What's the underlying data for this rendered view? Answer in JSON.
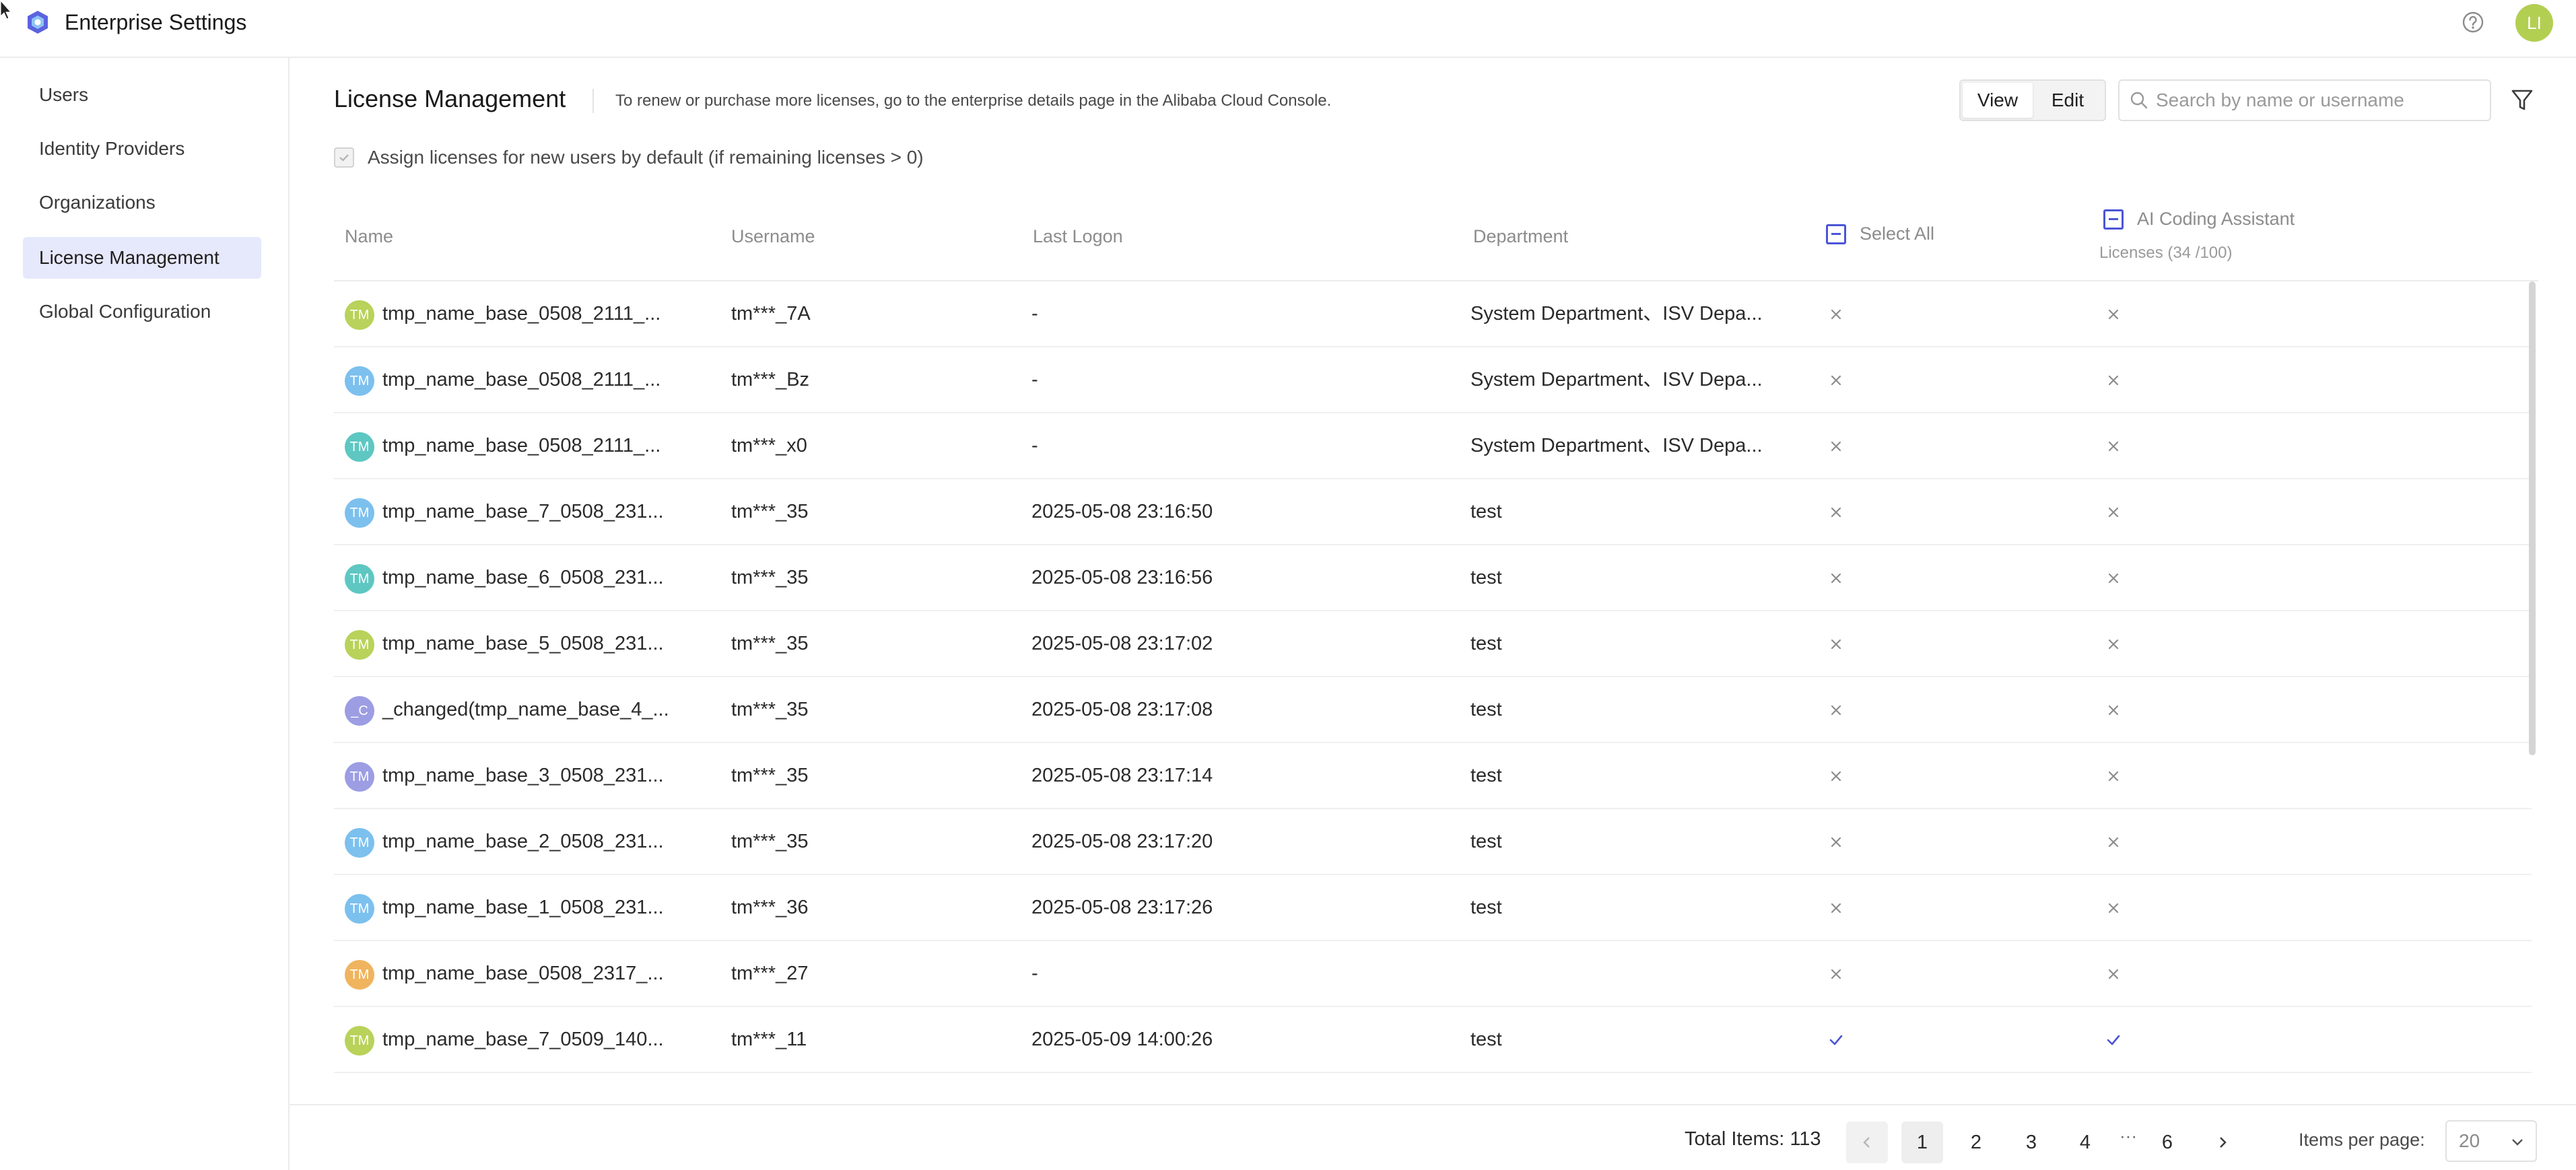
{
  "app": {
    "title": "Enterprise Settings",
    "avatar_initials": "LI"
  },
  "sidebar": {
    "items": [
      {
        "label": "Users"
      },
      {
        "label": "Identity Providers"
      },
      {
        "label": "Organizations"
      },
      {
        "label": "License Management",
        "active": true
      },
      {
        "label": "Global Configuration"
      }
    ]
  },
  "main": {
    "title": "License Management",
    "hint": "To renew or purchase more licenses, go to the enterprise details page in the Alibaba Cloud Console.",
    "view_label": "View",
    "edit_label": "Edit",
    "search_placeholder": "Search by name or username",
    "assign_default_label": "Assign licenses for new users by default (if remaining licenses > 0)"
  },
  "table": {
    "columns": {
      "name": "Name",
      "username": "Username",
      "last_logon": "Last Logon",
      "department": "Department",
      "select_all": "Select All",
      "product": "AI Coding Assistant",
      "product_sub": "Licenses (34 /100)"
    },
    "rows": [
      {
        "initials": "TM",
        "avatar_color": "#b8d25a",
        "name": "tmp_name_base_0508_2111_...",
        "username": "tm***_7A",
        "last_logon": "-",
        "department": "System Department、ISV Depa...",
        "select": "x",
        "license": "x"
      },
      {
        "initials": "TM",
        "avatar_color": "#7cc0ee",
        "name": "tmp_name_base_0508_2111_...",
        "username": "tm***_Bz",
        "last_logon": "-",
        "department": "System Department、ISV Depa...",
        "select": "x",
        "license": "x"
      },
      {
        "initials": "TM",
        "avatar_color": "#5ec7c2",
        "name": "tmp_name_base_0508_2111_...",
        "username": "tm***_x0",
        "last_logon": "-",
        "department": "System Department、ISV Depa...",
        "select": "x",
        "license": "x"
      },
      {
        "initials": "TM",
        "avatar_color": "#7cc0ee",
        "name": "tmp_name_base_7_0508_231...",
        "username": "tm***_35",
        "last_logon": "2025-05-08 23:16:50",
        "department": "test",
        "select": "x",
        "license": "x"
      },
      {
        "initials": "TM",
        "avatar_color": "#5ec7c2",
        "name": "tmp_name_base_6_0508_231...",
        "username": "tm***_35",
        "last_logon": "2025-05-08 23:16:56",
        "department": "test",
        "select": "x",
        "license": "x"
      },
      {
        "initials": "TM",
        "avatar_color": "#b8d25a",
        "name": "tmp_name_base_5_0508_231...",
        "username": "tm***_35",
        "last_logon": "2025-05-08 23:17:02",
        "department": "test",
        "select": "x",
        "license": "x"
      },
      {
        "initials": "_C",
        "avatar_color": "#9c9de3",
        "name": "_changed(tmp_name_base_4_...",
        "username": "tm***_35",
        "last_logon": "2025-05-08 23:17:08",
        "department": "test",
        "select": "x",
        "license": "x"
      },
      {
        "initials": "TM",
        "avatar_color": "#9c9de3",
        "name": "tmp_name_base_3_0508_231...",
        "username": "tm***_35",
        "last_logon": "2025-05-08 23:17:14",
        "department": "test",
        "select": "x",
        "license": "x"
      },
      {
        "initials": "TM",
        "avatar_color": "#7cc0ee",
        "name": "tmp_name_base_2_0508_231...",
        "username": "tm***_35",
        "last_logon": "2025-05-08 23:17:20",
        "department": "test",
        "select": "x",
        "license": "x"
      },
      {
        "initials": "TM",
        "avatar_color": "#7cc0ee",
        "name": "tmp_name_base_1_0508_231...",
        "username": "tm***_36",
        "last_logon": "2025-05-08 23:17:26",
        "department": "test",
        "select": "x",
        "license": "x"
      },
      {
        "initials": "TM",
        "avatar_color": "#f0b45e",
        "name": "tmp_name_base_0508_2317_...",
        "username": "tm***_27",
        "last_logon": "-",
        "department": "",
        "select": "x",
        "license": "x"
      },
      {
        "initials": "TM",
        "avatar_color": "#b8d25a",
        "name": "tmp_name_base_7_0509_140...",
        "username": "tm***_11",
        "last_logon": "2025-05-09 14:00:26",
        "department": "test",
        "select": "check",
        "license": "check"
      }
    ]
  },
  "pagination": {
    "total_label": "Total Items: 113",
    "pages": [
      "1",
      "2",
      "3",
      "4",
      "6"
    ],
    "ellipsis": "···",
    "current": "1",
    "items_per_page_label": "Items per page:",
    "items_per_page_value": "20"
  },
  "colors": {
    "accent": "#4b55d6",
    "active_nav_bg": "#e6e8fb"
  },
  "icons": {
    "logo": "hexagon-logo-icon",
    "help": "question-circle-icon",
    "search": "search-icon",
    "filter": "funnel-icon",
    "x": "close-icon",
    "check": "check-icon",
    "prev": "chevron-left-icon",
    "next": "chevron-right-icon",
    "dropdown": "chevron-down-icon"
  }
}
